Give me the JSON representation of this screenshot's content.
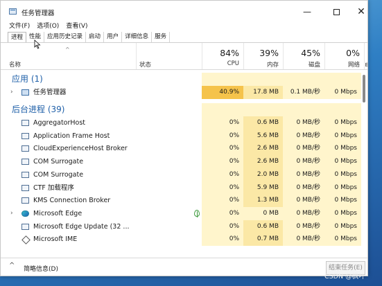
{
  "window": {
    "title": "任务管理器"
  },
  "controls": {
    "minimize": "—",
    "close": "✕"
  },
  "menu": [
    "文件(F)",
    "选项(O)",
    "查看(V)"
  ],
  "tabs": [
    "进程",
    "性能",
    "应用历史记录",
    "启动",
    "用户",
    "详细信息",
    "服务"
  ],
  "active_tab": "进程",
  "header": {
    "sort_caret": "^",
    "name": "名称",
    "status": "状态",
    "cpu": {
      "pct": "84%",
      "label": "CPU"
    },
    "memory": {
      "pct": "39%",
      "label": "内存"
    },
    "disk": {
      "pct": "45%",
      "label": "磁盘"
    },
    "network": {
      "pct": "0%",
      "label": "网络"
    },
    "power": {
      "label": "电"
    }
  },
  "groups": {
    "apps": "应用 (1)",
    "background": "后台进程 (39)"
  },
  "processes": [
    {
      "name": "任务管理器",
      "expand": "›",
      "icon": "task-manager-icon",
      "cpu": "40.9%",
      "mem": "17.8 MB",
      "disk": "0.1 MB/秒",
      "net": "0 Mbps"
    },
    {
      "name": "AggregatorHost",
      "expand": "",
      "icon": "app-window-icon",
      "cpu": "0%",
      "mem": "0.6 MB",
      "disk": "0 MB/秒",
      "net": "0 Mbps"
    },
    {
      "name": "Application Frame Host",
      "expand": "",
      "icon": "app-window-icon",
      "cpu": "0%",
      "mem": "5.6 MB",
      "disk": "0 MB/秒",
      "net": "0 Mbps"
    },
    {
      "name": "CloudExperienceHost Broker",
      "expand": "",
      "icon": "app-window-icon",
      "cpu": "0%",
      "mem": "2.6 MB",
      "disk": "0 MB/秒",
      "net": "0 Mbps"
    },
    {
      "name": "COM Surrogate",
      "expand": "",
      "icon": "app-window-icon",
      "cpu": "0%",
      "mem": "2.6 MB",
      "disk": "0 MB/秒",
      "net": "0 Mbps"
    },
    {
      "name": "COM Surrogate",
      "expand": "",
      "icon": "app-window-icon",
      "cpu": "0%",
      "mem": "2.0 MB",
      "disk": "0 MB/秒",
      "net": "0 Mbps"
    },
    {
      "name": "CTF 加载程序",
      "expand": "",
      "icon": "ctf-loader-icon",
      "cpu": "0%",
      "mem": "5.9 MB",
      "disk": "0 MB/秒",
      "net": "0 Mbps"
    },
    {
      "name": "KMS Connection Broker",
      "expand": "",
      "icon": "app-window-icon",
      "cpu": "0%",
      "mem": "1.3 MB",
      "disk": "0 MB/秒",
      "net": "0 Mbps"
    },
    {
      "name": "Microsoft Edge",
      "expand": "›",
      "icon": "edge-icon",
      "cpu": "0%",
      "mem": "0 MB",
      "disk": "0 MB/秒",
      "net": "0 Mbps"
    },
    {
      "name": "Microsoft Edge Update (32 ...",
      "expand": "",
      "icon": "app-window-icon",
      "cpu": "0%",
      "mem": "0.6 MB",
      "disk": "0 MB/秒",
      "net": "0 Mbps"
    },
    {
      "name": "Microsoft IME",
      "expand": "",
      "icon": "ime-icon",
      "cpu": "0%",
      "mem": "0.7 MB",
      "disk": "0 MB/秒",
      "net": "0 Mbps"
    }
  ],
  "footer": {
    "caret": "^",
    "fewer_details": "简略信息(D)",
    "end_task": "结束任务(E)"
  },
  "watermark": "CSDN @枫叶",
  "colors": {
    "heat_high": "#f5c34b",
    "heat_low": "#fff5cc",
    "heat_mid": "#fbe8a6",
    "group_text": "#1e5fa8"
  }
}
